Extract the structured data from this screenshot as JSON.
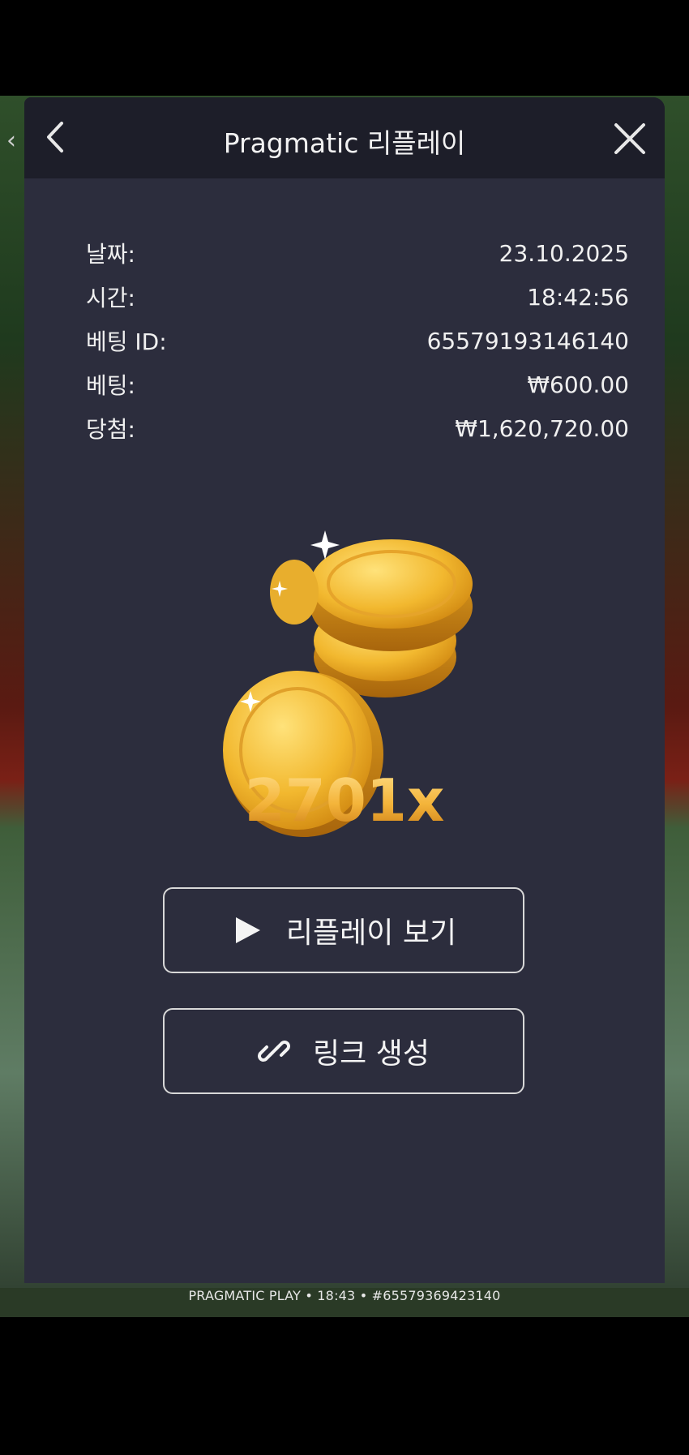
{
  "header": {
    "title": "Pragmatic 리플레이"
  },
  "details": [
    {
      "label": "날짜:",
      "value": "23.10.2025"
    },
    {
      "label": "시간:",
      "value": "18:42:56"
    },
    {
      "label": "베팅 ID:",
      "value": "65579193146140"
    },
    {
      "label": "베팅:",
      "value": "₩600.00"
    },
    {
      "label": "당첨:",
      "value": "₩1,620,720.00"
    }
  ],
  "win": {
    "multiplier": "2701x"
  },
  "buttons": {
    "replay_label": "리플레이 보기",
    "link_label": "링크 생성"
  },
  "footer": {
    "text": "PRAGMATIC PLAY • 18:43 • #65579369423140"
  },
  "icons": {
    "back": "chevron-left-icon",
    "close": "close-icon",
    "play": "play-icon",
    "link": "link-icon",
    "coins": "gold-coins-icon"
  },
  "colors": {
    "modal_bg": "#2c2d3d",
    "header_bg": "#1d1e29",
    "gold": "#f4b43a"
  }
}
